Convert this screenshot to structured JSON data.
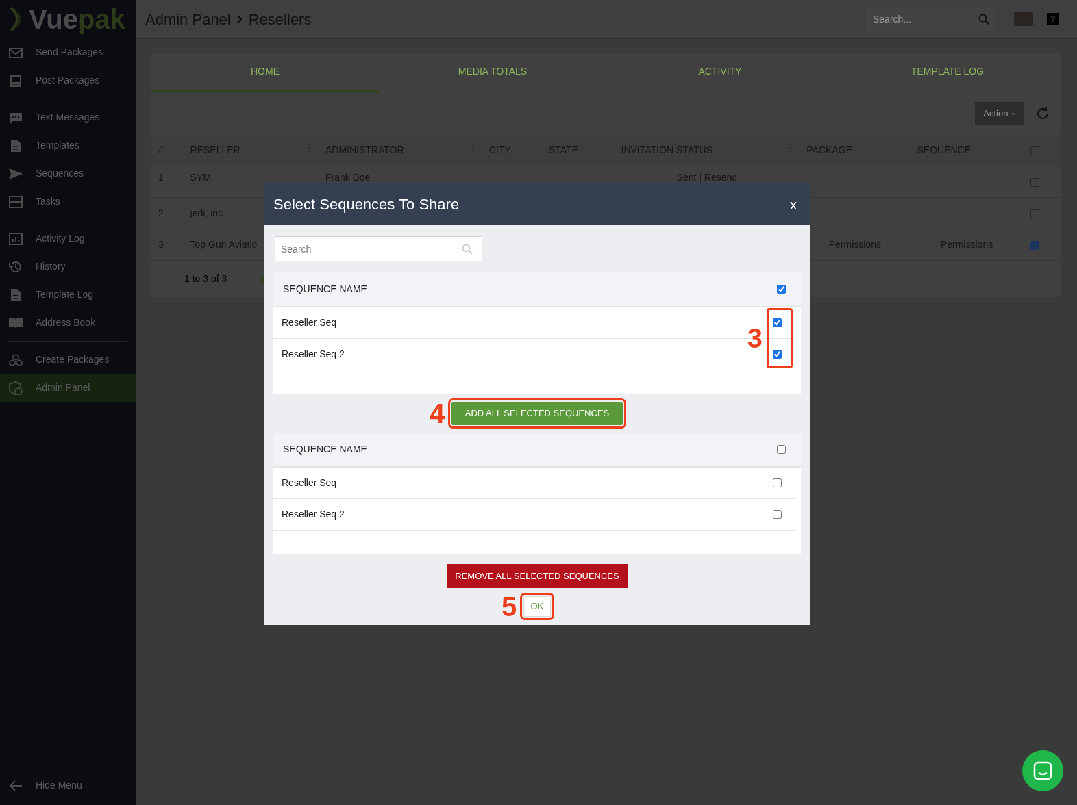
{
  "sidebar": {
    "logo": {
      "text_1": "Vue",
      "text_2": "pak"
    },
    "groups": [
      [
        {
          "label": "Send Packages",
          "selected": false
        },
        {
          "label": "Post Packages",
          "selected": false
        }
      ],
      [
        {
          "label": "Text Messages",
          "selected": false
        },
        {
          "label": "Templates",
          "selected": false
        },
        {
          "label": "Sequences",
          "selected": false
        },
        {
          "label": "Tasks",
          "selected": false
        }
      ],
      [
        {
          "label": "Activity Log",
          "selected": false
        },
        {
          "label": "History",
          "selected": false
        },
        {
          "label": "Template Log",
          "selected": false
        },
        {
          "label": "Address Book",
          "selected": false
        }
      ],
      [
        {
          "label": "Create Packages",
          "selected": false
        },
        {
          "label": "Admin Panel",
          "selected": true
        }
      ]
    ],
    "footer": "Hide Menu"
  },
  "header": {
    "breadcrumb": [
      "Admin Panel",
      "Resellers"
    ],
    "search": {
      "placeholder": "Search..."
    },
    "help": "?"
  },
  "tabs": [
    {
      "label": "HOME",
      "selected": true
    },
    {
      "label": "MEDIA TOTALS",
      "selected": false
    },
    {
      "label": "ACTIVITY",
      "selected": false
    },
    {
      "label": "TEMPLATE LOG",
      "selected": false
    }
  ],
  "toolbar": {
    "action_button": "Action"
  },
  "table": {
    "columns": [
      {
        "label": "#",
        "sortable": false
      },
      {
        "label": "RESELLER",
        "sortable": true
      },
      {
        "label": "ADMINISTRATOR",
        "sortable": true
      },
      {
        "label": "CITY",
        "sortable": false
      },
      {
        "label": "STATE",
        "sortable": false
      },
      {
        "label": "INVITATION STATUS",
        "sortable": true
      },
      {
        "label": "PACKAGE",
        "sortable": false
      },
      {
        "label": "SEQUENCE",
        "sortable": false
      }
    ],
    "header_checked": false,
    "rows": [
      {
        "cells": [
          "1",
          "SYM",
          "Frank Doe",
          "",
          "",
          "Sent | Resend",
          "",
          ""
        ],
        "checked": false
      },
      {
        "cells": [
          "2",
          "jedi, inc",
          "",
          "",
          "",
          "",
          "",
          ""
        ],
        "checked": false
      },
      {
        "cells": [
          "3",
          "Top Gun Aviatio",
          "",
          "",
          "",
          "",
          "Permissions",
          "Permissions"
        ],
        "checked": true
      }
    ],
    "pagination": "1 to 3 of 3"
  },
  "modal": {
    "title": "Select Sequences To Share",
    "close": "x",
    "search": {
      "placeholder": "Search"
    },
    "available": {
      "column": "SEQUENCE NAME",
      "all_checked": true,
      "callout": "3",
      "rows": [
        {
          "name": "Reseller Seq",
          "checked": true
        },
        {
          "name": "Reseller Seq 2",
          "checked": true
        }
      ]
    },
    "add_button": {
      "label": "ADD ALL SELECTED SEQUENCES",
      "callout": "4"
    },
    "shared": {
      "column": "SEQUENCE NAME",
      "all_checked": false,
      "rows": [
        {
          "name": "Reseller Seq",
          "checked": false
        },
        {
          "name": "Reseller Seq 2",
          "checked": false
        }
      ]
    },
    "remove_button": {
      "label": "REMOVE ALL SELECTED SEQUENCES"
    },
    "ok_button": {
      "label": "OK",
      "callout": "5"
    }
  }
}
